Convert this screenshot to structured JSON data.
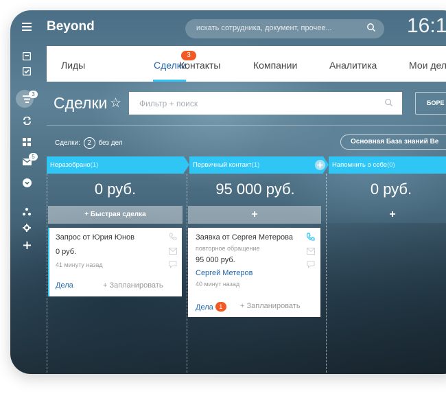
{
  "app": {
    "logo": "Beyond",
    "time": "16:1"
  },
  "search": {
    "placeholder": "искать сотрудника, документ, прочее..."
  },
  "sidebar": {
    "badges": {
      "deals": "3",
      "mail": "5"
    }
  },
  "tabs": [
    {
      "label": "Лиды"
    },
    {
      "label": "Сделки",
      "badge": "3"
    },
    {
      "label": "Контакты"
    },
    {
      "label": "Компании"
    },
    {
      "label": "Аналитика"
    },
    {
      "label": "Мои дел"
    }
  ],
  "page": {
    "title": "Сделки",
    "filter_placeholder": "Фильтр + поиск",
    "action_button": "БОРЕ",
    "deals_label": "Сделки:",
    "deals_count": "2",
    "deals_suffix": "без дел",
    "knowledge_base": "Основная База знаний Ве"
  },
  "columns": [
    {
      "name": "Неразобрано",
      "count": "(1)",
      "sum": "0 руб.",
      "add_label": "+ Быстрая сделка"
    },
    {
      "name": "Первичный контакт",
      "count": "(1)",
      "sum": "95 000 руб.",
      "add_label": "+"
    },
    {
      "name": "Напомнить о себе",
      "count": "(0)",
      "sum": "0 руб.",
      "add_label": "+"
    }
  ],
  "cards": [
    {
      "title": "Запрос от Юрия Юнов",
      "amount": "0 руб.",
      "time": "41 минуту назад",
      "tasks": "Дела",
      "plan": "+ Запланировать"
    },
    {
      "title": "Заявка от Сергея Метерова",
      "subtitle": "повторное обращение",
      "amount": "95 000 руб.",
      "contact": "Сергей Метеров",
      "time": "40 минут назад",
      "tasks": "Дела",
      "tasks_badge": "1",
      "plan": "+ Запланировать"
    }
  ],
  "colors": {
    "accent": "#2fc6f6",
    "link": "#2067b0",
    "badge": "#f15a24"
  }
}
